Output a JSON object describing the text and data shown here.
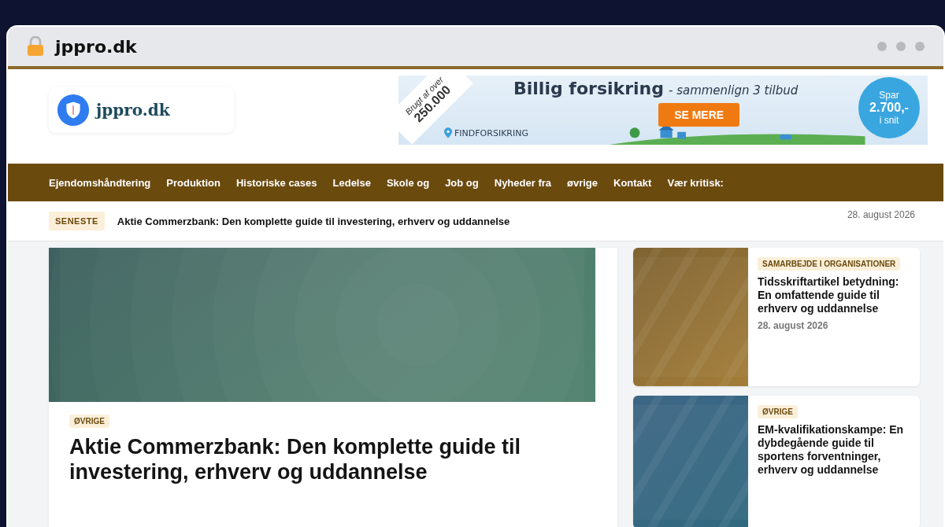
{
  "browser": {
    "address": "jppro.dk"
  },
  "site": {
    "logo_text": "jppro.dk"
  },
  "ad": {
    "ribbon_top": "Brugt af over",
    "ribbon_number": "250.000",
    "brand": "FINDFORSIKRING",
    "headline": "Billig forsikring",
    "subline": "- sammenlign 3 tilbud",
    "button": "SE MERE",
    "badge_top": "Spar",
    "badge_amount": "2.700,-",
    "badge_bottom": "i snit"
  },
  "nav": {
    "items": [
      {
        "label": "Ejendomshåndtering"
      },
      {
        "label": "Produktion"
      },
      {
        "label": "Historiske cases"
      },
      {
        "label": "Ledelse"
      },
      {
        "label": "Skole og"
      },
      {
        "label": "Job og"
      },
      {
        "label": "Nyheder fra"
      },
      {
        "label": "øvrige"
      },
      {
        "label": "Kontakt"
      },
      {
        "label": "Vær kritisk:"
      }
    ]
  },
  "ticker": {
    "label": "SENESTE",
    "headline": "Aktie Commerzbank: Den komplette guide til investering, erhverv og uddannelse",
    "date": "28. august 2026"
  },
  "featured": {
    "category": "ØVRIGE",
    "title": "Aktie Commerzbank: Den komplette guide til investering, erhverv og uddannelse"
  },
  "sidebar": [
    {
      "category": "SAMARBEJDE I ORGANISATIONER",
      "title": "Tidsskriftartikel betydning: En omfattende guide til erhverv og uddannelse",
      "date": "28. august 2026"
    },
    {
      "category": "ØVRIGE",
      "title": "EM-kvalifikationskampe: En dybdegående guide til sportens forventninger, erhverv og uddannelse"
    }
  ]
}
